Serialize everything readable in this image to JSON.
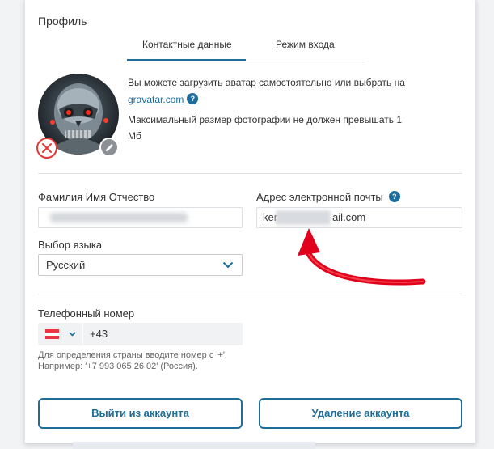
{
  "profile": {
    "title": "Профиль"
  },
  "tabs": [
    {
      "label": "Контактные данные",
      "active": true
    },
    {
      "label": "Режим входа",
      "active": false
    }
  ],
  "avatar": {
    "upload_text": "Вы можете загрузить аватар самостоятельно или выбрать на",
    "gravatar_link": "gravatar.com",
    "size_note": "Максимальный размер фотографии не должен превышать 1 Мб"
  },
  "help_mark": "?",
  "fields": {
    "full_name_label": "Фамилия Имя Отчество",
    "email_label": "Адрес электронной почты",
    "email_prefix": "ker",
    "email_suffix": "ail.com",
    "language_label": "Выбор языка",
    "language_value": "Русский",
    "phone_label": "Телефонный номер",
    "phone_code": "+43",
    "phone_hint": "Для определения страны вводите номер с '+'. Например: '+7 993 065 26 02' (Россия)."
  },
  "buttons": {
    "logout": "Выйти из аккаунта",
    "delete": "Удаление аккаунта"
  },
  "colors": {
    "accent": "#1e6d9a",
    "danger": "#e53935",
    "annotation_arrow": "#e0001b"
  }
}
